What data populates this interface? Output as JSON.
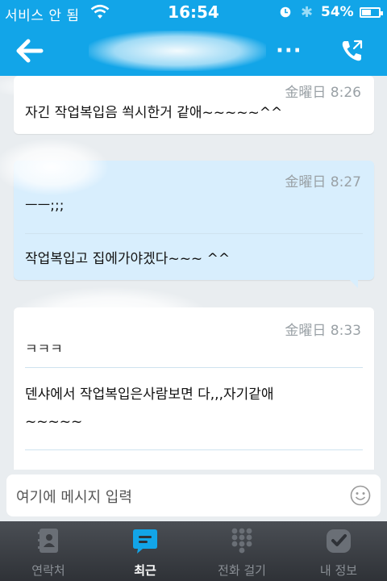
{
  "status_bar": {
    "carrier": "서비스 안 됨",
    "time": "16:54",
    "battery_percent": "54%",
    "battery_level": 0.54
  },
  "header": {
    "more_label": "···"
  },
  "messages": [
    {
      "timestamp": "金曜日 8:26",
      "lines": [
        "자긴 작업복입음 쐭시한거 같애~~~~~^^"
      ],
      "mine": false
    },
    {
      "timestamp": "金曜日 8:27",
      "lines": [
        "ㅡㅡ;;;",
        "작업복입고 집에가야겠다~~~ ^^"
      ],
      "mine": true
    },
    {
      "timestamp": "金曜日 8:33",
      "lines": [
        "ㅋㅋㅋ",
        "덴샤에서 작업복입은사람보면  다,,,자기같애",
        "~~~~~"
      ],
      "mine": false
    }
  ],
  "composer": {
    "placeholder": "여기에 메시지 입력"
  },
  "tabs": [
    {
      "label": "연락처",
      "icon": "contacts-icon",
      "active": false
    },
    {
      "label": "최근",
      "icon": "recent-chat-icon",
      "active": true
    },
    {
      "label": "전화 걸기",
      "icon": "dialpad-icon",
      "active": false
    },
    {
      "label": "내 정보",
      "icon": "profile-icon",
      "active": false
    }
  ],
  "colors": {
    "brand_blue": "#12a5e8",
    "own_bubble": "#d8eefd",
    "tab_bar": "#3a3d42"
  }
}
